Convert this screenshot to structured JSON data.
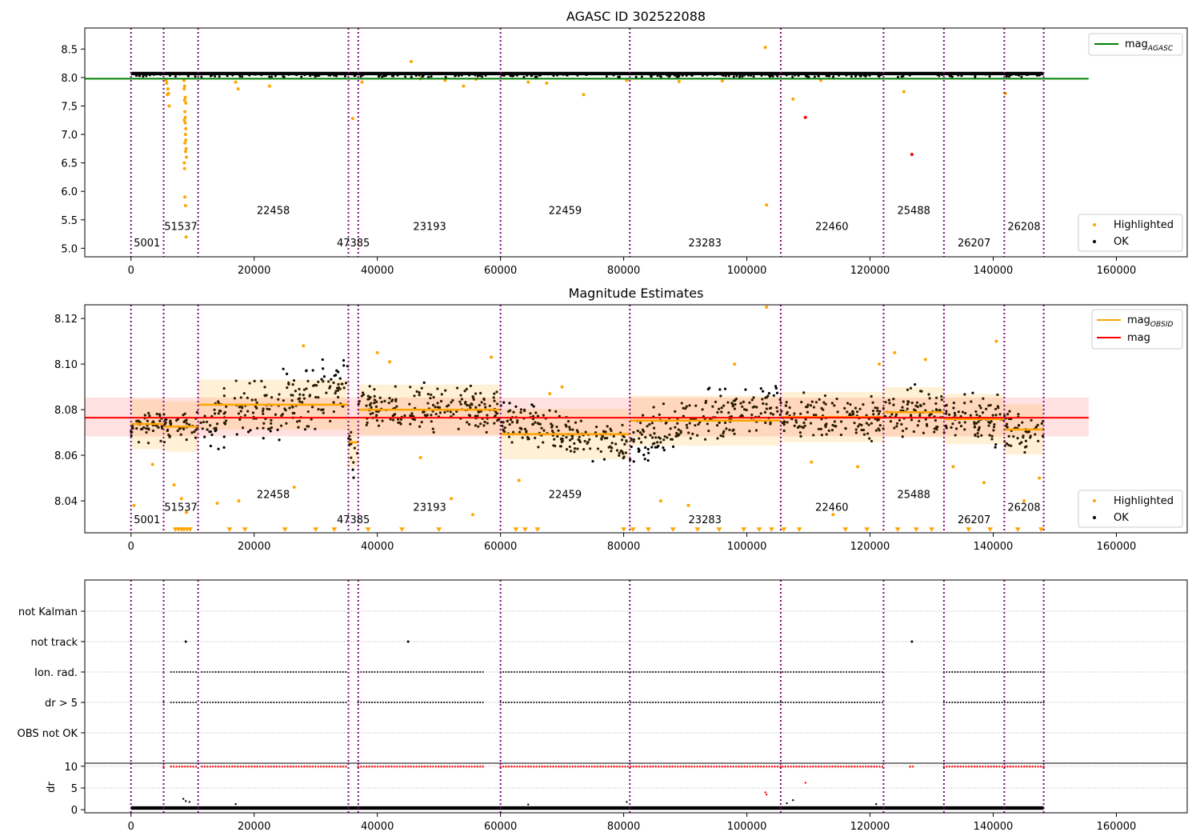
{
  "chart_data": [
    {
      "type": "scatter",
      "title": "AGASC ID 302522088",
      "xlabel": "",
      "ylabel": "",
      "xlim": [
        -7500,
        171500
      ],
      "ylim": [
        4.85,
        8.87
      ],
      "xticks": [
        0,
        20000,
        40000,
        60000,
        80000,
        100000,
        120000,
        140000,
        160000
      ],
      "yticks": [
        5.0,
        5.5,
        6.0,
        6.5,
        7.0,
        7.5,
        8.0,
        8.5
      ],
      "ytick_labels": [
        "5.0",
        "5.5",
        "6.0",
        "6.5",
        "7.0",
        "7.5",
        "8.0",
        "8.5"
      ],
      "obs_boundaries": [
        0,
        5300,
        10900,
        35300,
        36900,
        60000,
        81000,
        105500,
        122200,
        132000,
        141800,
        148200
      ],
      "obsid_labels": [
        {
          "text": "5001",
          "x": 2600,
          "y": 5.03
        },
        {
          "text": "51537",
          "x": 8100,
          "y": 5.32
        },
        {
          "text": "22458",
          "x": 23100,
          "y": 5.6
        },
        {
          "text": "47385",
          "x": 36100,
          "y": 5.03
        },
        {
          "text": "23193",
          "x": 48500,
          "y": 5.32
        },
        {
          "text": "22459",
          "x": 70500,
          "y": 5.6
        },
        {
          "text": "23283",
          "x": 93200,
          "y": 5.03
        },
        {
          "text": "22460",
          "x": 113800,
          "y": 5.32
        },
        {
          "text": "25488",
          "x": 127100,
          "y": 5.6
        },
        {
          "text": "26207",
          "x": 136900,
          "y": 5.03
        },
        {
          "text": "26208",
          "x": 145000,
          "y": 5.32
        }
      ],
      "ok_band": {
        "start": 0,
        "end": 148200,
        "low": 8.04,
        "high": 8.1
      },
      "mag_agasc": {
        "label": "mag_AGASC",
        "value": 7.98,
        "x_end": 155500,
        "color": "#008000"
      },
      "highlighted": {
        "label": "Highlighted",
        "color": "#ffa500",
        "x": [
          5800,
          5900,
          6000,
          6100,
          5700,
          6200,
          8600,
          8650,
          8700,
          8750,
          8800,
          8850,
          8900,
          8950,
          9000,
          8650,
          8700,
          8800,
          8900,
          8750,
          8850,
          8950,
          8700,
          8800,
          8900,
          8650,
          8750,
          8850,
          17000,
          17400,
          22500,
          36000,
          37500,
          45500,
          47000,
          51000,
          54000,
          56000,
          64500,
          67500,
          73500,
          80500,
          89000,
          96000,
          103000,
          103200,
          107500,
          112000,
          125500,
          142000
        ],
        "y": [
          7.9,
          7.7,
          7.8,
          7.72,
          7.95,
          7.5,
          7.95,
          7.8,
          7.6,
          7.4,
          7.2,
          7.0,
          6.9,
          6.75,
          6.6,
          6.5,
          6.4,
          7.3,
          7.1,
          5.9,
          5.75,
          5.2,
          7.85,
          7.65,
          7.55,
          7.25,
          6.85,
          6.7,
          7.92,
          7.8,
          7.85,
          7.28,
          7.92,
          8.28,
          7.98,
          7.95,
          7.85,
          7.97,
          7.92,
          7.9,
          7.7,
          7.95,
          7.93,
          7.94,
          8.53,
          5.76,
          7.62,
          7.95,
          7.75,
          7.72
        ]
      },
      "flagged": {
        "color": "#ff0000",
        "x": [
          109500,
          126800
        ],
        "y": [
          7.3,
          6.65
        ]
      },
      "ok": {
        "label": "OK",
        "color": "#000000"
      },
      "legend": {
        "upper": "top-right",
        "lower": "bottom-right"
      }
    },
    {
      "type": "scatter",
      "title": "Magnitude Estimates",
      "xlabel": "",
      "ylabel": "",
      "xlim": [
        -7500,
        171500
      ],
      "ylim": [
        8.026,
        8.126
      ],
      "xticks": [
        0,
        20000,
        40000,
        60000,
        80000,
        100000,
        120000,
        140000,
        160000
      ],
      "yticks": [
        8.04,
        8.06,
        8.08,
        8.1,
        8.12
      ],
      "ytick_labels": [
        "8.04",
        "8.06",
        "8.08",
        "8.10",
        "8.12"
      ],
      "obs_boundaries": [
        0,
        5300,
        10900,
        35300,
        36900,
        60000,
        81000,
        105500,
        122200,
        132000,
        141800,
        148200
      ],
      "obsid_labels": [
        {
          "text": "5001",
          "x": 2600,
          "y": 8.0302
        },
        {
          "text": "51537",
          "x": 8100,
          "y": 8.0357
        },
        {
          "text": "22458",
          "x": 23100,
          "y": 8.0412
        },
        {
          "text": "47385",
          "x": 36100,
          "y": 8.0302
        },
        {
          "text": "23193",
          "x": 48500,
          "y": 8.0357
        },
        {
          "text": "22459",
          "x": 70500,
          "y": 8.0412
        },
        {
          "text": "23283",
          "x": 93200,
          "y": 8.0302
        },
        {
          "text": "22460",
          "x": 113800,
          "y": 8.0357
        },
        {
          "text": "25488",
          "x": 127100,
          "y": 8.0412
        },
        {
          "text": "26207",
          "x": 136900,
          "y": 8.0302
        },
        {
          "text": "26208",
          "x": 145000,
          "y": 8.0357
        }
      ],
      "mag": {
        "label": "mag",
        "value": 8.0765,
        "low": 8.0683,
        "high": 8.0853,
        "x_end": 155500,
        "color": "#ff0000",
        "band_color": "#ffc8c8"
      },
      "mag_obsid": {
        "label": "mag_OBSID",
        "color": "#ffa500",
        "segments": [
          {
            "start": 0,
            "end": 5300,
            "value": 8.0737,
            "low": 8.065,
            "high": 8.083,
            "trend": "flat"
          },
          {
            "start": 5300,
            "end": 10900,
            "value": 8.0726,
            "low": 8.064,
            "high": 8.082,
            "trend": "flat"
          },
          {
            "start": 10900,
            "end": 35300,
            "value": 8.0822,
            "low": 8.065,
            "high": 8.099,
            "trend": "rise"
          },
          {
            "start": 35300,
            "end": 36900,
            "value": 8.0657,
            "low": 8.05,
            "high": 8.079,
            "trend": "dip"
          },
          {
            "start": 36900,
            "end": 60000,
            "value": 8.08,
            "low": 8.069,
            "high": 8.094,
            "trend": "flat"
          },
          {
            "start": 60000,
            "end": 81000,
            "value": 8.0693,
            "low": 8.058,
            "high": 8.083,
            "trend": "fall"
          },
          {
            "start": 81000,
            "end": 105500,
            "value": 8.0752,
            "low": 8.061,
            "high": 8.09,
            "trend": "rise"
          },
          {
            "start": 105500,
            "end": 122200,
            "value": 8.0768,
            "low": 8.064,
            "high": 8.091,
            "trend": "flat"
          },
          {
            "start": 122200,
            "end": 132000,
            "value": 8.0789,
            "low": 8.067,
            "high": 8.097,
            "trend": "flat"
          },
          {
            "start": 132000,
            "end": 141800,
            "value": 8.0759,
            "low": 8.064,
            "high": 8.09,
            "trend": "flat"
          },
          {
            "start": 141800,
            "end": 148200,
            "value": 8.0713,
            "low": 8.058,
            "high": 8.087,
            "trend": "flat"
          }
        ]
      },
      "highlighted": {
        "label": "Highlighted",
        "color": "#ffa500",
        "x": [
          500,
          3500,
          7000,
          8200,
          9000,
          14000,
          17500,
          26500,
          28000,
          40000,
          42000,
          47000,
          52000,
          55500,
          58500,
          63000,
          68000,
          70000,
          86000,
          90500,
          98000,
          103200,
          110500,
          114000,
          118000,
          121500,
          124000,
          129000,
          133500,
          138500,
          140500,
          145000,
          147500
        ],
        "y": [
          8.038,
          8.056,
          8.047,
          8.041,
          8.035,
          8.039,
          8.04,
          8.046,
          8.108,
          8.105,
          8.101,
          8.059,
          8.041,
          8.034,
          8.103,
          8.049,
          8.087,
          8.09,
          8.04,
          8.038,
          8.1,
          8.125,
          8.057,
          8.034,
          8.055,
          8.1,
          8.105,
          8.102,
          8.055,
          8.048,
          8.11,
          8.04,
          8.05
        ]
      },
      "below_axis": {
        "color": "#ffa500",
        "y": 8.0275,
        "x": [
          7200,
          7700,
          8200,
          8600,
          9100,
          9600,
          16000,
          18500,
          25000,
          30000,
          33000,
          38500,
          44000,
          50000,
          62500,
          64000,
          66000,
          80000,
          81500,
          84000,
          88000,
          92000,
          95500,
          99500,
          102000,
          104000,
          106000,
          108500,
          116000,
          119500,
          124500,
          127500,
          130000,
          136000,
          139500,
          144000,
          147800
        ]
      },
      "ok": {
        "label": "OK",
        "color": "#000000"
      },
      "legend": {
        "upper": "top-right",
        "lower": "bottom-right"
      }
    },
    {
      "type": "scatter",
      "title": "",
      "xlabel": "",
      "ylabel": "",
      "xlim": [
        -7500,
        171500
      ],
      "categories": [
        "OBS not OK",
        "dr > 5",
        "Ion. rad.",
        "not track",
        "not Kalman"
      ],
      "obs_boundaries": [
        0,
        5300,
        10900,
        35300,
        36900,
        60000,
        81000,
        105500,
        122200,
        132000,
        141800,
        148200
      ],
      "flag_ranges": [
        {
          "category": "Ion. rad.",
          "ranges": [
            [
              5300,
              5500
            ],
            [
              6500,
              10900
            ],
            [
              11500,
              35300
            ],
            [
              36900,
              57500
            ],
            [
              60000,
              105500
            ],
            [
              105800,
              122200
            ],
            [
              132000,
              148200
            ]
          ]
        },
        {
          "category": "dr > 5",
          "ranges": [
            [
              5300,
              5500
            ],
            [
              6500,
              10900
            ],
            [
              11500,
              35300
            ],
            [
              36900,
              57500
            ],
            [
              60000,
              105500
            ],
            [
              105800,
              122200
            ],
            [
              132000,
              148200
            ]
          ]
        }
      ],
      "not_track_points": [
        8900,
        45000,
        126800
      ],
      "point_color": "#000000"
    },
    {
      "type": "scatter",
      "title": "",
      "xlabel": "",
      "ylabel": "dr",
      "xlim": [
        -7500,
        171500
      ],
      "ylim": [
        -0.7,
        10.7
      ],
      "xticks": [
        0,
        20000,
        40000,
        60000,
        80000,
        100000,
        120000,
        140000,
        160000
      ],
      "yticks": [
        0,
        5,
        10
      ],
      "ytick_labels": [
        "0",
        "5",
        "10"
      ],
      "obs_boundaries": [
        0,
        5300,
        10900,
        35300,
        36900,
        60000,
        81000,
        105500,
        122200,
        132000,
        141800,
        148200
      ],
      "ok_range": [
        0,
        148200
      ],
      "ok_band": {
        "low": 0,
        "high": 0.8
      },
      "capped": {
        "value": 10,
        "color": "#ff0000",
        "ranges": [
          [
            5300,
            5500
          ],
          [
            6500,
            10900
          ],
          [
            11500,
            35300
          ],
          [
            36900,
            57500
          ],
          [
            60000,
            105500
          ],
          [
            105800,
            122200
          ],
          [
            126500,
            127000
          ],
          [
            132000,
            148200
          ]
        ]
      },
      "outliers": {
        "color": "#ff0000",
        "x": [
          103000,
          103200,
          109500
        ],
        "y": [
          4.0,
          3.5,
          6.2
        ]
      },
      "ok_outliers": {
        "color": "#000000",
        "x": [
          8500,
          8900,
          9500,
          17000,
          64500,
          80500,
          106500,
          107500,
          121000
        ],
        "y": [
          2.5,
          2.0,
          1.8,
          1.3,
          1.2,
          1.8,
          1.5,
          2.2,
          1.3
        ]
      },
      "ok": {
        "color": "#000000"
      }
    }
  ]
}
